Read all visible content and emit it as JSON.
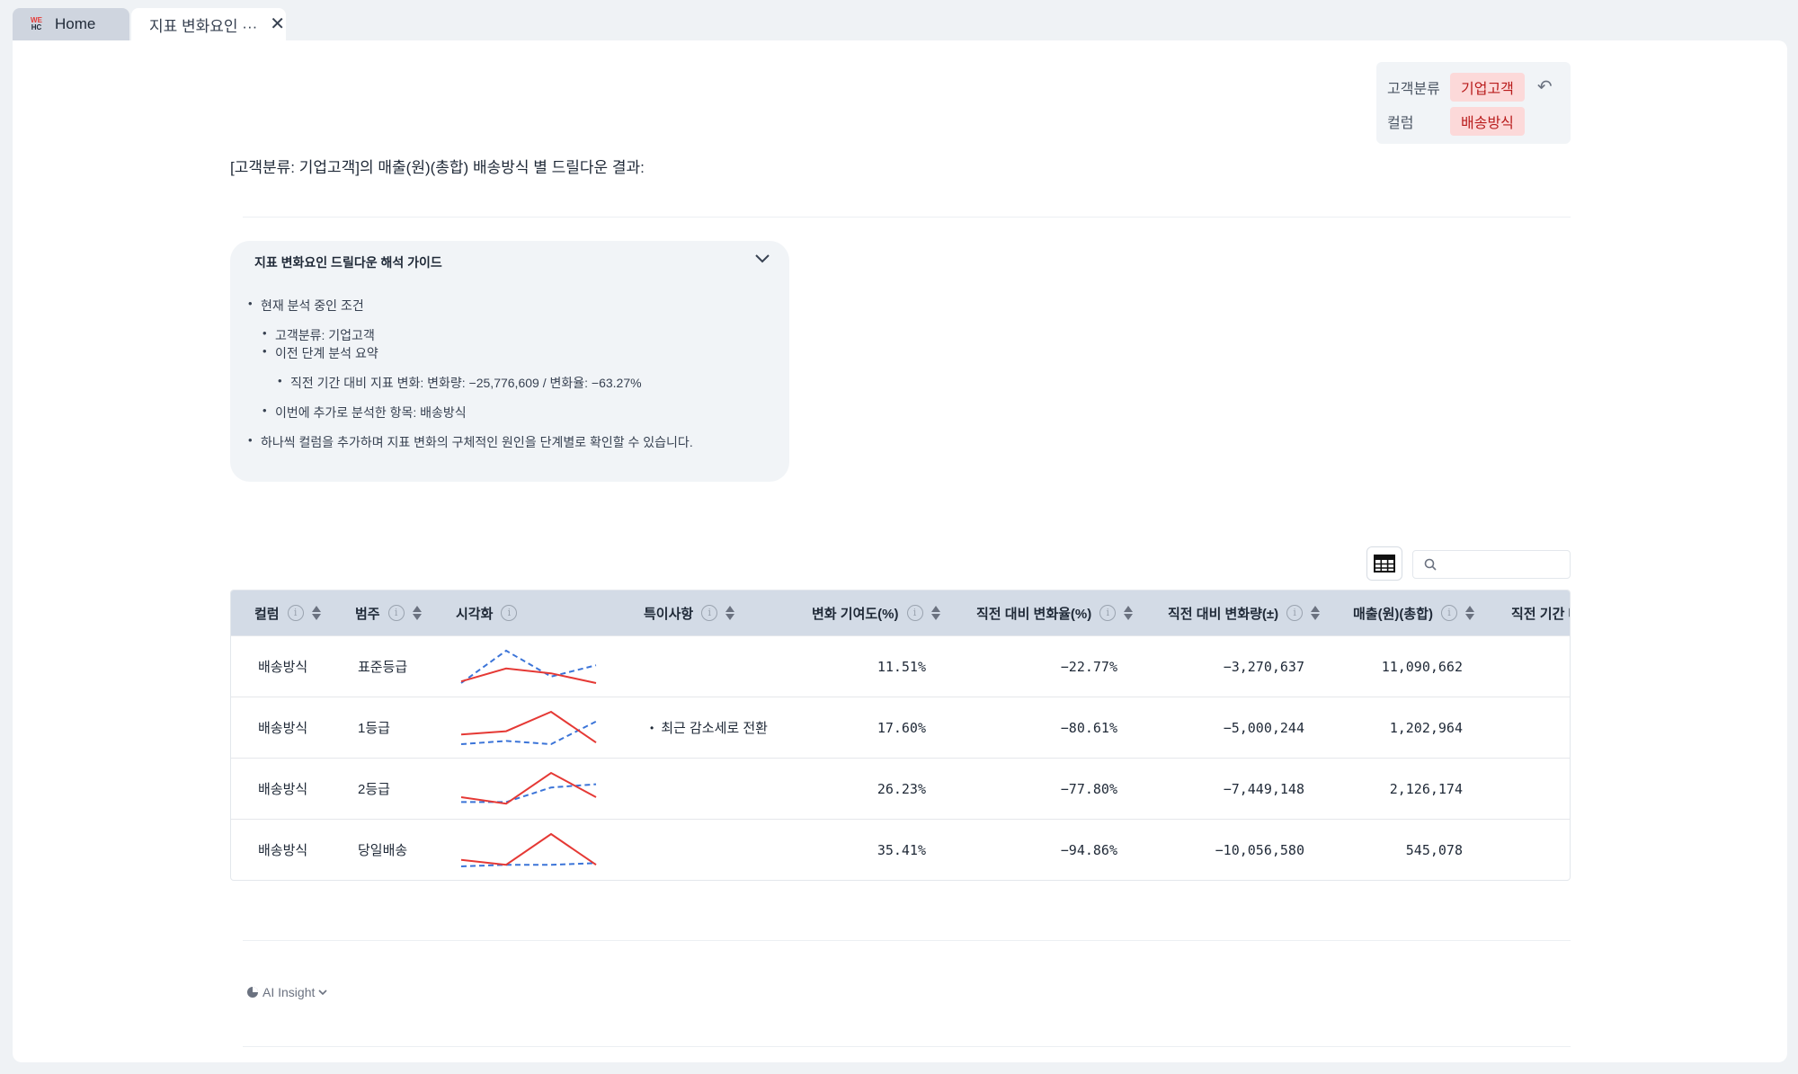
{
  "tabs": {
    "logo_top": "WE",
    "logo_bottom": "HC",
    "home_label": "Home",
    "active_label": "지표 변화요인 ···",
    "close_glyph": "✕"
  },
  "filters": {
    "rows": [
      {
        "key": "고객분류",
        "value": "기업고객"
      },
      {
        "key": "컬럼",
        "value": "배송방식"
      }
    ],
    "undo_glyph": "↶"
  },
  "result_title": "[고객분류: 기업고객]의 매출(원)(총합) 배송방식 별 드릴다운 결과:",
  "guide": {
    "title": "지표 변화요인 드릴다운 해석 가이드",
    "chevron": "⌄",
    "items": [
      "현재 분석 중인 조건",
      "고객분류: 기업고객",
      "이전 단계 분석 요약",
      "직전 기간 대비 지표 변화: 변화량: −25,776,609 / 변화율: −63.27%",
      "이번에 추가로 분석한 항목: 배송방식",
      "하나씩 컬럼을 추가하며 지표 변화의 구체적인 원인을 단계별로 확인할 수 있습니다."
    ]
  },
  "search": {
    "placeholder": ""
  },
  "table": {
    "headers": [
      "컬럼",
      "범주",
      "시각화",
      "특이사항",
      "변화 기여도(%)",
      "직전 대비 변화율(%)",
      "직전 대비 변화량(±)",
      "매출(원)(총합)",
      "직전 기간 매"
    ],
    "info_glyph": "i",
    "rows": [
      {
        "column": "배송방식",
        "category": "표준등급",
        "note": "",
        "contribution": "11.51%",
        "rate": "−22.77%",
        "amount": "−3,270,637",
        "sales": "11,090,662",
        "spark_red": [
          0.05,
          0.45,
          0.3,
          0.0
        ],
        "spark_blue": [
          0.0,
          1.0,
          0.2,
          0.55
        ]
      },
      {
        "column": "배송방식",
        "category": "1등급",
        "note": "최근 감소세로 전환",
        "contribution": "17.60%",
        "rate": "−80.61%",
        "amount": "−5,000,244",
        "sales": "1,202,964",
        "spark_red": [
          0.3,
          0.4,
          1.0,
          0.05
        ],
        "spark_blue": [
          0.0,
          0.1,
          0.0,
          0.7
        ]
      },
      {
        "column": "배송방식",
        "category": "2등급",
        "note": "",
        "contribution": "26.23%",
        "rate": "−77.80%",
        "amount": "−7,449,148",
        "sales": "2,126,174",
        "spark_red": [
          0.25,
          0.05,
          1.0,
          0.25
        ],
        "spark_blue": [
          0.1,
          0.1,
          0.55,
          0.65
        ]
      },
      {
        "column": "배송방식",
        "category": "당일배송",
        "note": "",
        "contribution": "35.41%",
        "rate": "−94.86%",
        "amount": "−10,056,580",
        "sales": "545,078",
        "spark_red": [
          0.2,
          0.05,
          1.0,
          0.05
        ],
        "spark_blue": [
          0.0,
          0.05,
          0.05,
          0.1
        ]
      }
    ]
  },
  "ai_insight": {
    "label": "AI Insight",
    "chevron": "⌄"
  },
  "colors": {
    "accent_red": "#e53935",
    "accent_blue": "#3b74d8",
    "chip_bg": "#fcd9d9"
  }
}
